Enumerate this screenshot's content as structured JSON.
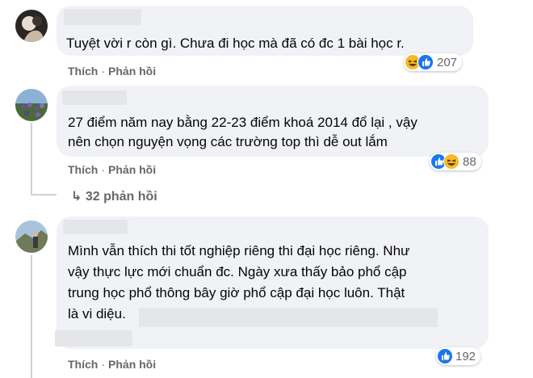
{
  "comments": [
    {
      "text": "Tuyệt vời r còn gì. Chưa đi học mà đã có đc 1 bài học r.",
      "like_label": "Thích",
      "reply_label": "Phản hồi",
      "reactions": [
        "haha",
        "like"
      ],
      "reaction_count": "207"
    },
    {
      "text": "27 điểm năm nay bằng 22-23 điểm khoá 2014 đổ lại , vậy\nnên chọn nguyện vọng các trường top thì dễ out lắm",
      "like_label": "Thích",
      "reply_label": "Phản hồi",
      "reactions": [
        "like",
        "haha"
      ],
      "reaction_count": "88",
      "view_replies": "↳ 32 phản hồi"
    },
    {
      "text": "Mình vẫn thích thi tốt nghiệp riêng thi đại học riêng. Như\nvậy thực lực mới chuẩn đc. Ngày xưa thấy bảo phổ cập\ntrung học phổ thông bây giờ phổ cập đại học luôn. Thật\nlà vi diệu.",
      "like_label": "Thích",
      "reply_label": "Phản hồi",
      "reactions": [
        "like"
      ],
      "reaction_count": "192"
    }
  ],
  "dot_separator": "·",
  "colors": {
    "like": "#1877f2",
    "haha": "#f7b928",
    "bubble": "#f0f2f5",
    "meta": "#65676b"
  }
}
